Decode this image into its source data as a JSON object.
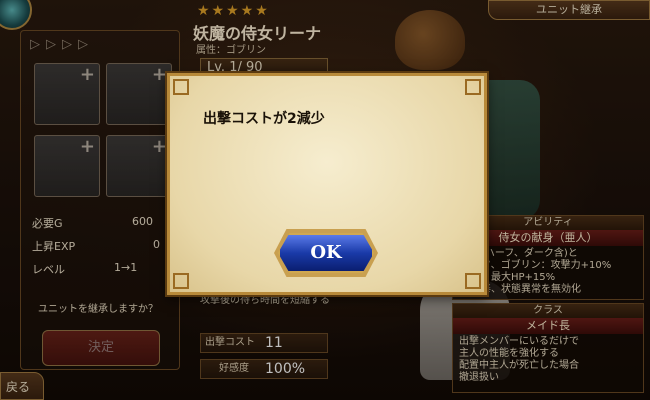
{
  "left_panel": {
    "stats": [
      {
        "label": "必要G",
        "value": "600"
      },
      {
        "label": "上昇EXP",
        "value": "0"
      },
      {
        "label": "レベル",
        "value": "1→1"
      }
    ],
    "confirm_text": "ユニットを継承しますか？",
    "decide_label": "決定",
    "back_label": "戻る"
  },
  "unit": {
    "stars": "★★★★★",
    "name": "妖魔の侍女リーナ",
    "attribute": "属性：ゴブリン",
    "level": "Lv. 1/ 90",
    "skill_desc": "攻撃後の待ち時間を短縮する",
    "cost_label": "出撃コスト",
    "cost_value": "11",
    "affection_label": "好感度",
    "affection_value": "100%"
  },
  "right": {
    "inherit_tab": "ユニット継承",
    "ability_header": "アビリティ",
    "ability_name": "侍女の献身（亜人）",
    "ability_lines": [
      "(ハーフ、ダーク含)と",
      "フ、ゴブリン：攻撃力+10%",
      "：最大HP+15%",
      "毒、状態異常を無効化"
    ],
    "class_header": "クラス",
    "class_name": "メイド長",
    "class_lines": [
      "出撃メンバーにいるだけで",
      "主人の性能を強化する",
      "配置中主人が死亡した場合",
      "撤退扱い"
    ]
  },
  "dialog": {
    "message": "出撃コストが2減少",
    "ok_label": "OK"
  },
  "colors": {
    "accent_gold": "#e0a22a",
    "ok_blue": "#1a3aa8",
    "dialog_bg": "#f6edcf"
  }
}
